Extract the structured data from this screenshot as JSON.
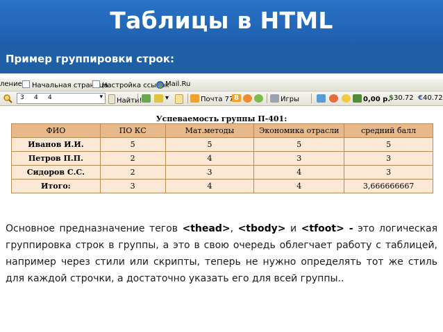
{
  "slide": {
    "title": "Таблицы в HTML",
    "subtitle": "Пример группировки строк:"
  },
  "browser": {
    "bookmarks": [
      {
        "label": "ление"
      },
      {
        "label": "Начальная страница"
      },
      {
        "label": "Настройка ссылок"
      },
      {
        "label": "Mail.Ru"
      }
    ],
    "toolbar": {
      "search_value": "3     4     4",
      "find_label": "Найти!",
      "mail_label": "Почта 77",
      "mail_badge": "8",
      "games_label": "Игры",
      "money_label": "0,00 р.",
      "usd_label": "30.72",
      "eur_label": "40.72"
    }
  },
  "table": {
    "caption": "Успеваемость группы П-401:",
    "headers": [
      "ФИО",
      "ПО КС",
      "Мат.методы",
      "Экономика отрасли",
      "средний балл"
    ],
    "rows": [
      [
        "Иванов И.И.",
        "5",
        "5",
        "5",
        "5"
      ],
      [
        "Петров П.П.",
        "2",
        "4",
        "3",
        "3"
      ],
      [
        "Сидоров С.С.",
        "2",
        "3",
        "4",
        "3"
      ]
    ],
    "footer": [
      "Итого:",
      "3",
      "4",
      "4",
      "3,666666667"
    ]
  },
  "body_text": {
    "line_start": "Основное предназначение тегов ",
    "tag_thead": "<thead>",
    "comma": ", ",
    "tag_tbody": "<tbody>",
    "and": " и ",
    "tag_tfoot": "<tfoot> -",
    "rest": " это логическая группировка строк в группы, а это в свою очередь облегчает работу с таблицей, например через стили или скрипты, теперь не нужно определять тот же стиль для каждой строчки, а достаточно указать его для всей группы.."
  },
  "colors": {
    "title_band": "#2a73c7",
    "subtitle_band": "#1e5fa5",
    "table_header": "#e7b98a",
    "table_cell": "#fbe9d6",
    "table_border": "#b88a53"
  }
}
